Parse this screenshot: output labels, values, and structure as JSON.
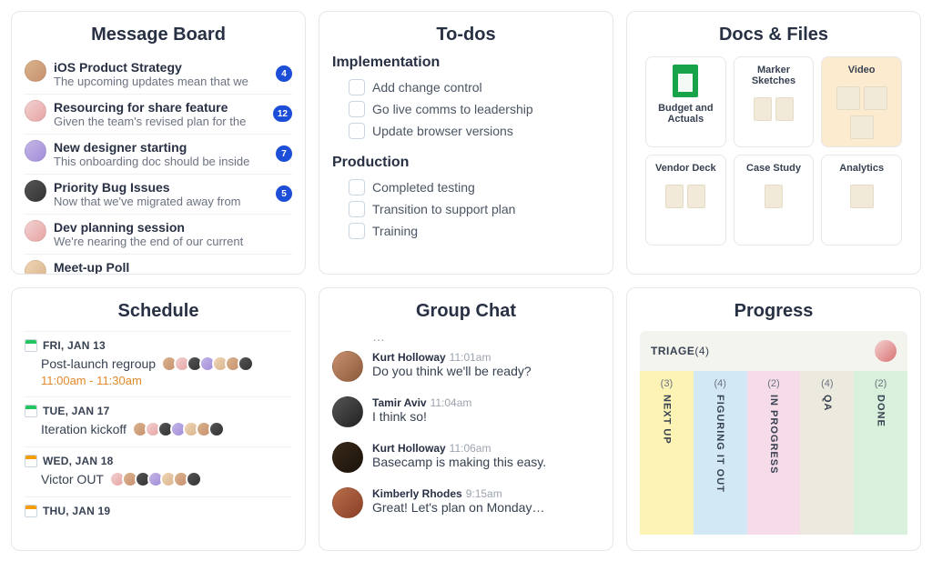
{
  "cards": {
    "message_board": {
      "title": "Message Board",
      "rows": [
        {
          "title": "iOS Product Strategy",
          "sub": "The upcoming updates mean that we",
          "count": "4"
        },
        {
          "title": "Resourcing for share feature",
          "sub": "Given the team's revised plan for the",
          "count": "12"
        },
        {
          "title": "New designer starting",
          "sub": "This onboarding doc should be inside",
          "count": "7"
        },
        {
          "title": "Priority Bug Issues",
          "sub": "Now that we've migrated away from",
          "count": "5"
        },
        {
          "title": "Dev planning session",
          "sub": "We're nearing the end of our current",
          "count": ""
        },
        {
          "title": "Meet-up Poll",
          "sub": "",
          "count": ""
        }
      ]
    },
    "todos": {
      "title": "To-dos",
      "sections": [
        {
          "label": "Implementation",
          "items": [
            "Add change control",
            "Go live comms to leadership",
            "Update browser versions"
          ]
        },
        {
          "label": "Production",
          "items": [
            "Completed testing",
            "Transition to support plan",
            "Training"
          ]
        }
      ]
    },
    "docs": {
      "title": "Docs & Files",
      "tiles": [
        {
          "label": "Budget and Actuals"
        },
        {
          "label": "Marker Sketches"
        },
        {
          "label": "Video"
        },
        {
          "label": "Vendor Deck"
        },
        {
          "label": "Case Study"
        },
        {
          "label": "Analytics"
        }
      ]
    },
    "schedule": {
      "title": "Schedule",
      "blocks": [
        {
          "date": "FRI, JAN 13",
          "event": "Post-launch regroup",
          "time": "11:00am - 11:30am"
        },
        {
          "date": "TUE, JAN 17",
          "event": "Iteration kickoff",
          "time": ""
        },
        {
          "date": "WED, JAN 18",
          "event": "Victor OUT",
          "time": ""
        },
        {
          "date": "THU, JAN 19",
          "event": "",
          "time": ""
        }
      ]
    },
    "chat": {
      "title": "Group Chat",
      "msgs": [
        {
          "name": "Kurt Holloway",
          "time": "11:01am",
          "text": "Do you think we'll be ready?"
        },
        {
          "name": "Tamir Aviv",
          "time": "11:04am",
          "text": "I think so!"
        },
        {
          "name": "Kurt Holloway",
          "time": "11:06am",
          "text": "Basecamp is making this easy."
        },
        {
          "name": "Kimberly Rhodes",
          "time": "9:15am",
          "text": "Great! Let's plan on Monday…"
        }
      ]
    },
    "progress": {
      "title": "Progress",
      "triage_label": "TRIAGE",
      "triage_count": "(4)",
      "lanes": [
        {
          "count": "(3)",
          "label": "NEXT UP"
        },
        {
          "count": "(4)",
          "label": "FIGURING IT OUT"
        },
        {
          "count": "(2)",
          "label": "IN PROGRESS"
        },
        {
          "count": "(4)",
          "label": "QA"
        },
        {
          "count": "(2)",
          "label": "DONE"
        }
      ]
    }
  }
}
